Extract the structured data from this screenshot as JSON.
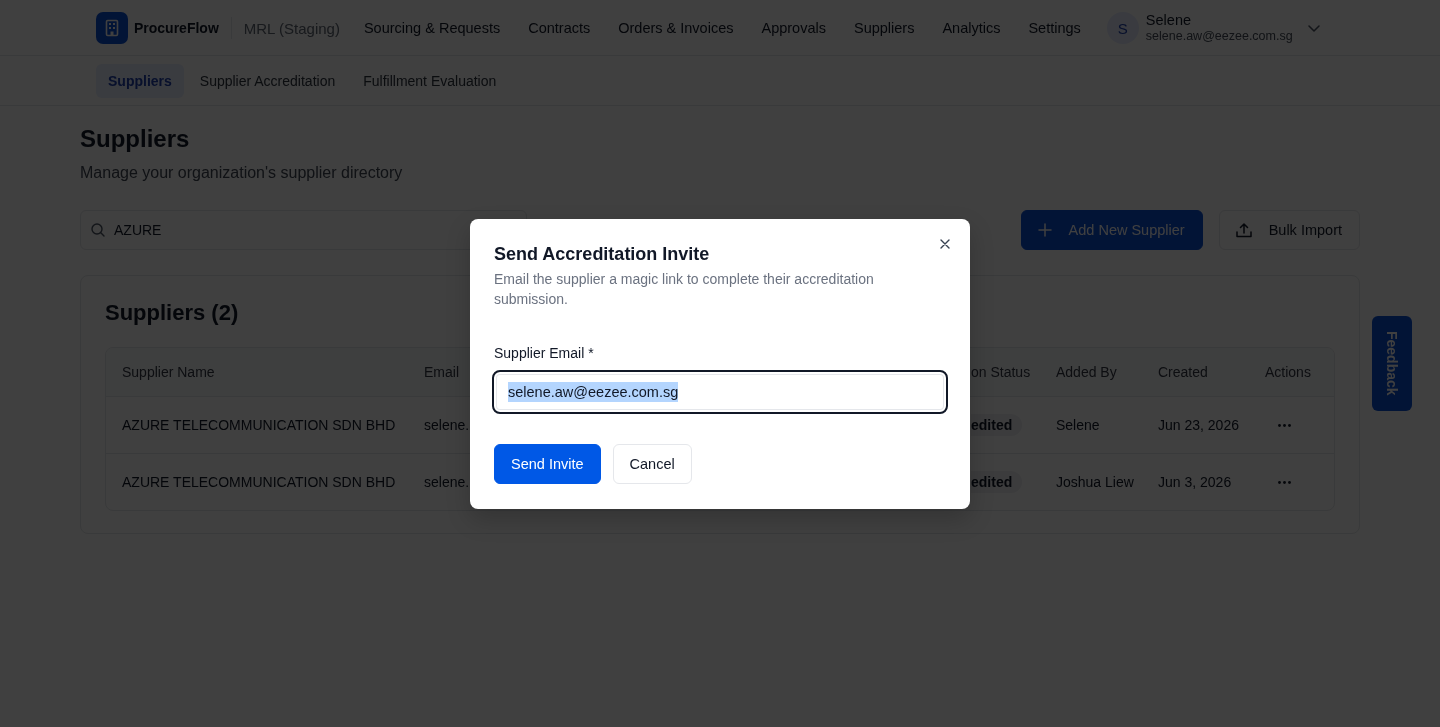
{
  "header": {
    "brand": "ProcureFlow",
    "workspace": "MRL (Staging)",
    "nav": [
      "Sourcing & Requests",
      "Contracts",
      "Orders & Invoices",
      "Approvals",
      "Suppliers",
      "Analytics",
      "Settings"
    ],
    "user": {
      "initial": "S",
      "name": "Selene",
      "email": "selene.aw@eezee.com.sg"
    }
  },
  "subnav": [
    {
      "label": "Suppliers",
      "selected": true
    },
    {
      "label": "Supplier Accreditation",
      "selected": false
    },
    {
      "label": "Fulfillment Evaluation",
      "selected": false
    }
  ],
  "page": {
    "title": "Suppliers",
    "subtitle": "Manage your organization's supplier directory"
  },
  "search": {
    "value": "AZURE"
  },
  "actions": [
    {
      "kind": "add",
      "label": "Add New Supplier"
    },
    {
      "kind": "import",
      "label": "Bulk Import"
    }
  ],
  "card": {
    "title": "Suppliers (2)"
  },
  "table": {
    "columns": [
      "Supplier Name",
      "Email",
      "on Status",
      "Added By",
      "Created",
      "Actions"
    ],
    "rows": [
      {
        "supplier_name": "AZURE TELECOMMUNICATION SDN BHD",
        "email": "selene.",
        "status": "edited",
        "added_by": "Selene",
        "created": "Jun 23, 2026"
      },
      {
        "supplier_name": "AZURE TELECOMMUNICATION SDN BHD",
        "email": "selene.",
        "status": "edited",
        "added_by": "Joshua Liew",
        "created": "Jun 3, 2026"
      }
    ]
  },
  "feedback_tab": {
    "label": "Feedback"
  },
  "modal": {
    "title": "Send Accreditation Invite",
    "description": "Email the supplier a magic link to complete their accreditation submission.",
    "field": {
      "label": "Supplier Email *",
      "value": "selene.aw@eezee.com.sg",
      "focused": true,
      "value_selected": true
    },
    "buttons": [
      {
        "kind": "primary",
        "label": "Send Invite"
      },
      {
        "kind": "secondary",
        "label": "Cancel"
      }
    ]
  }
}
